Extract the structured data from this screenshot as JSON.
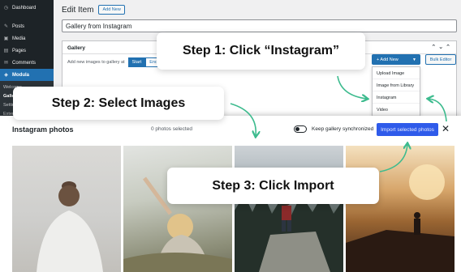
{
  "sidebar": {
    "items": [
      {
        "label": "Dashboard",
        "icon": "dashboard-icon",
        "glyph": "◷"
      },
      {
        "label": "Posts",
        "icon": "pin-icon",
        "glyph": "✎"
      },
      {
        "label": "Media",
        "icon": "media-icon",
        "glyph": "▣"
      },
      {
        "label": "Pages",
        "icon": "pages-icon",
        "glyph": "▤"
      },
      {
        "label": "Comments",
        "icon": "comments-icon",
        "glyph": "✉"
      }
    ],
    "active": {
      "label": "Modula",
      "icon": "modula-icon",
      "glyph": "◈"
    },
    "subitems": [
      "Welcome",
      "Galleries",
      "Settings",
      "Extensions"
    ]
  },
  "header": {
    "title": "Edit Item",
    "add_new": "Add New"
  },
  "title_input": {
    "value": "Gallery from Instagram"
  },
  "gallery_box": {
    "heading": "Gallery",
    "add_text": "Add new images to gallery at",
    "start": "Start",
    "end": "End",
    "add_new_button": "+ Add New",
    "bulk_editor": "Bulk Editor",
    "dropdown": [
      "Upload Image",
      "Image from Library",
      "Instagram",
      "Video"
    ]
  },
  "modal": {
    "title": "Instagram photos",
    "selected_count": "0 photos selected",
    "keep_sync": "Keep gallery synchronized",
    "import_button": "Import selected photos",
    "close": "✕"
  },
  "callouts": {
    "step1": "Step 1: Click “Instagram”",
    "step2": "Step 2: Select Images",
    "step3": "Step 3: Click Import"
  },
  "colors": {
    "accent": "#2271b1",
    "import": "#2f5bea",
    "arrow": "#3dbb8e",
    "sidebar": "#1d2327"
  }
}
